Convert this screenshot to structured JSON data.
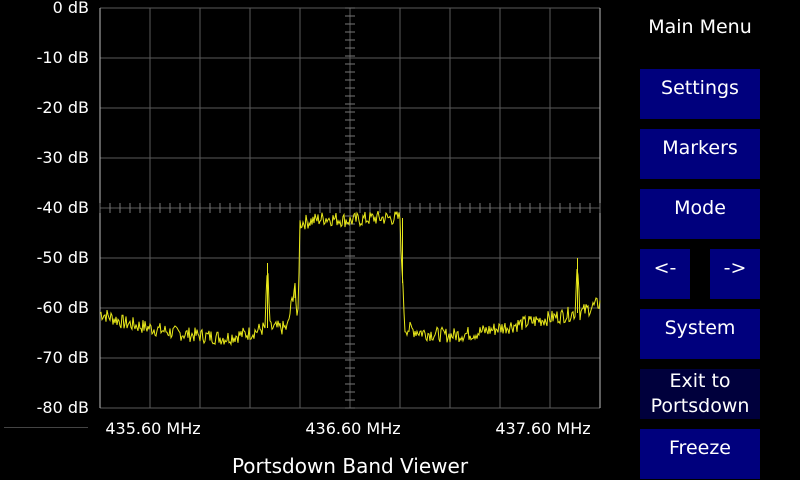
{
  "menu": {
    "title": "Main Menu",
    "buttons": {
      "settings": "Settings",
      "markers": "Markers",
      "mode": "Mode",
      "left": "<-",
      "right": "->",
      "system": "System",
      "exit_line1": "Exit to",
      "exit_line2": "Portsdown",
      "freeze": "Freeze"
    }
  },
  "footer": {
    "title": "Portsdown Band Viewer"
  },
  "colors": {
    "trace": "#e8e81a",
    "grid": "#5a5a5a",
    "button": "#00007d",
    "button_dim": "#00003c"
  },
  "chart_data": {
    "type": "line",
    "title": "",
    "xlabel": "",
    "ylabel": "",
    "y_unit": "dB",
    "ylim": [
      -80,
      0
    ],
    "xlim": [
      435.6,
      437.6
    ],
    "grid": true,
    "y_tick_labels": [
      "0 dB",
      "-10 dB",
      "-20 dB",
      "-30 dB",
      "-40 dB",
      "-50 dB",
      "-60 dB",
      "-70 dB",
      "-80 dB"
    ],
    "x_tick_labels": [
      "435.60 MHz",
      "436.60 MHz",
      "437.60 MHz"
    ],
    "series": [
      {
        "x": [
          435.6,
          435.7,
          435.8,
          435.9,
          436.0,
          436.1,
          436.2,
          436.26,
          436.27,
          436.28,
          436.35,
          436.38,
          436.39,
          436.4,
          436.5,
          436.6,
          436.7,
          436.8,
          436.81,
          436.82,
          436.9,
          437.0,
          437.1,
          437.2,
          437.3,
          437.4,
          437.5,
          437.51,
          437.52,
          437.6
        ],
        "y": [
          -61,
          -63,
          -64,
          -65,
          -65.5,
          -66,
          -65,
          -64,
          -51,
          -64,
          -64,
          -55,
          -65,
          -43,
          -42,
          -42.5,
          -42,
          -42,
          -55,
          -64,
          -65,
          -65.5,
          -65,
          -64,
          -63,
          -62,
          -61,
          -50,
          -61,
          -59
        ]
      }
    ]
  }
}
